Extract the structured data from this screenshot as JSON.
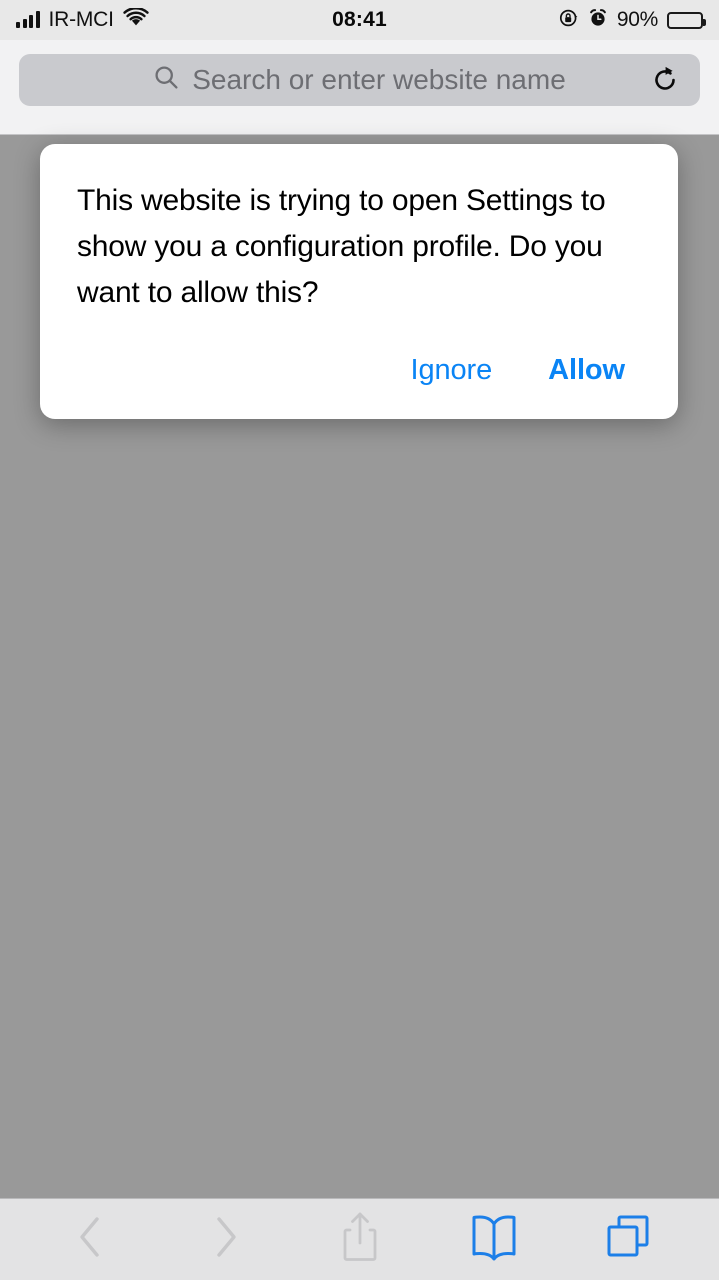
{
  "status_bar": {
    "carrier": "IR-MCI",
    "signal_bars_filled": 4,
    "signal_bars_total": 4,
    "wifi_icon": "wifi-icon",
    "time": "08:41",
    "rotation_lock_icon": "rotation-lock-icon",
    "alarm_icon": "alarm-clock-icon",
    "battery_percent": "90%",
    "battery_level": 90,
    "battery_icon": "battery-icon",
    "background_color": "#E8E8E8",
    "text_color": "#111111"
  },
  "browser_header": {
    "background_color": "#F2F2F3",
    "url_bar": {
      "value": "",
      "placeholder": "Search or enter website name",
      "background_color": "#C9CACE",
      "placeholder_color": "#6D6E73",
      "search_icon": "search-icon",
      "reload_icon": "reload-icon"
    }
  },
  "page": {
    "background_color": "#999999"
  },
  "dialog": {
    "message": "This website is trying to open Settings to show you a configuration profile. Do you want to allow this?",
    "background_color": "#FFFFFF",
    "text_color": "#000000",
    "accent_color": "#0A84F5",
    "buttons": {
      "secondary_label": "Ignore",
      "primary_label": "Allow"
    }
  },
  "bottom_toolbar": {
    "background_color": "#E3E3E4",
    "disabled_color": "#C7C7C9",
    "active_color": "#1C7FE8",
    "items": [
      {
        "name": "back-button",
        "icon": "chevron-left-icon",
        "enabled": false
      },
      {
        "name": "forward-button",
        "icon": "chevron-right-icon",
        "enabled": false
      },
      {
        "name": "share-button",
        "icon": "share-icon",
        "enabled": false
      },
      {
        "name": "bookmarks-button",
        "icon": "book-icon",
        "enabled": true
      },
      {
        "name": "tabs-button",
        "icon": "tabs-icon",
        "enabled": true
      }
    ]
  }
}
